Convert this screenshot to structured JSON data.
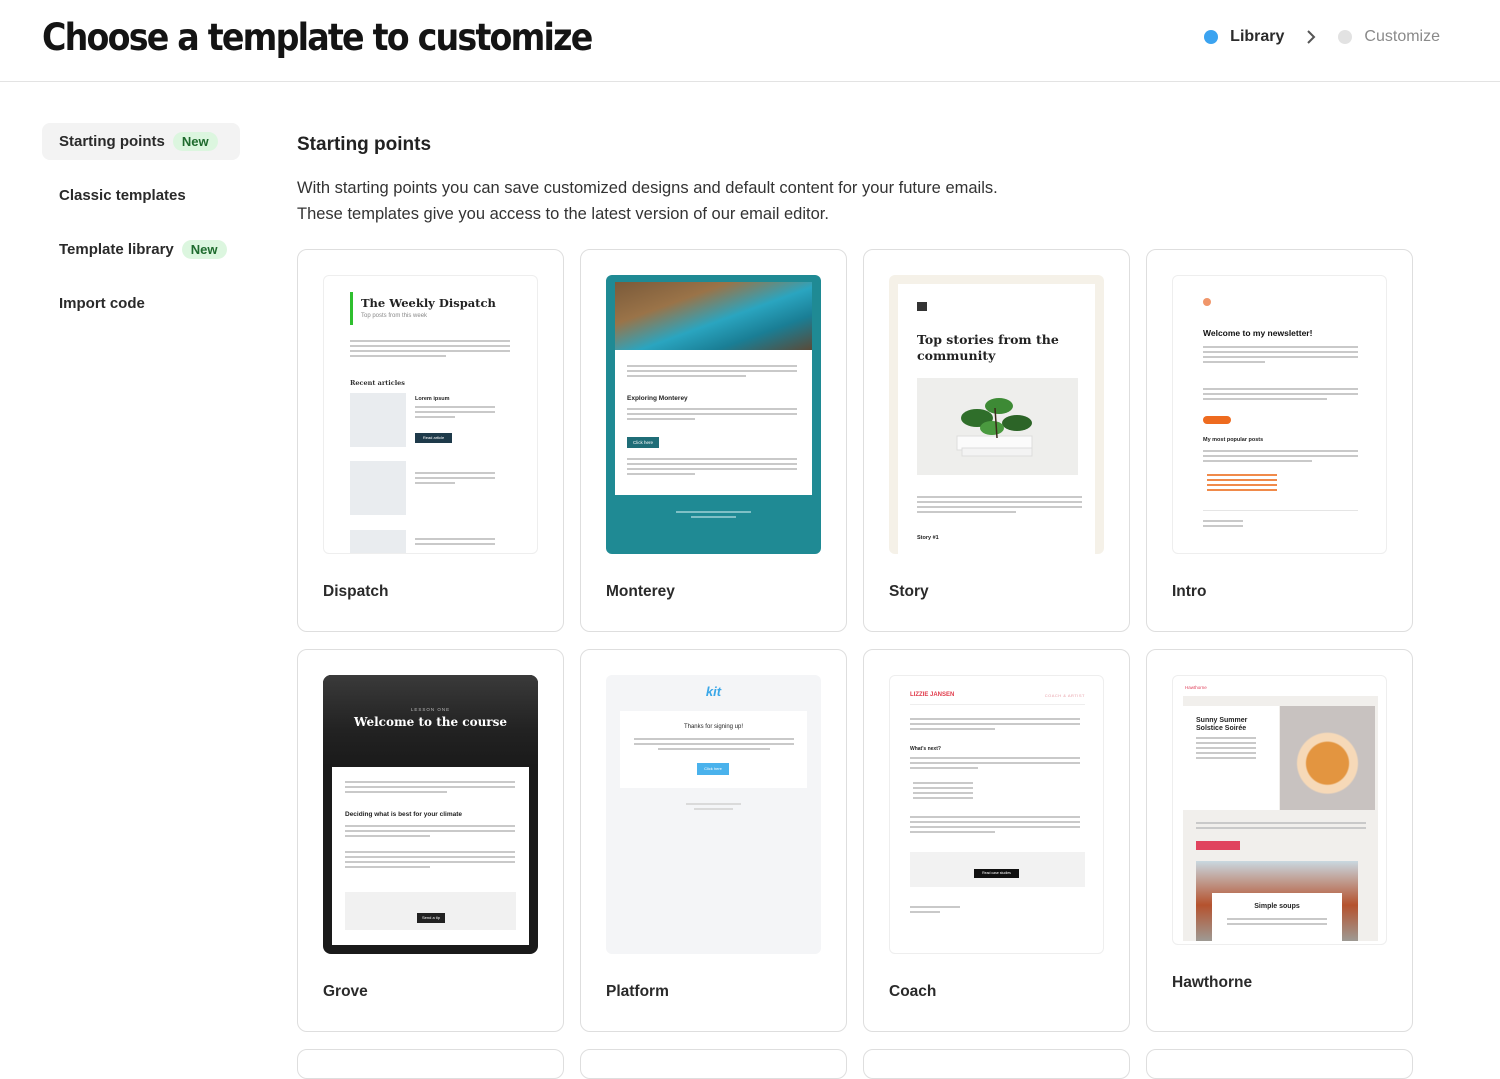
{
  "header": {
    "title": "Choose a template to customize",
    "steps": [
      {
        "label": "Library",
        "color": "#3ba3f0"
      },
      {
        "label": "Customize",
        "color": "#e2e2e2"
      }
    ]
  },
  "sidebar": {
    "items": [
      {
        "label": "Starting points",
        "badge": "New"
      },
      {
        "label": "Classic templates"
      },
      {
        "label": "Template library",
        "badge": "New"
      },
      {
        "label": "Import code"
      }
    ]
  },
  "main": {
    "title": "Starting points",
    "description_line1": "With starting points you can save customized designs and default content for your future emails.",
    "description_line2": "These templates give you access to the latest version of our email editor."
  },
  "templates": [
    {
      "name": "Dispatch",
      "preview": {
        "heading": "The Weekly Dispatch",
        "sub": "Top posts from this week",
        "section": "Recent articles",
        "item": "Lorem ipsum",
        "button": "Read article"
      }
    },
    {
      "name": "Monterey",
      "preview": {
        "heading": "Exploring Monterey",
        "button": "Click here"
      }
    },
    {
      "name": "Story",
      "preview": {
        "heading": "Top stories from the community",
        "item": "Story #1"
      }
    },
    {
      "name": "Intro",
      "preview": {
        "heading": "Welcome to my newsletter!",
        "section": "My most popular posts"
      }
    },
    {
      "name": "Grove",
      "preview": {
        "kicker": "LESSON ONE",
        "heading": "Welcome to the course",
        "section": "Deciding what is best for your climate",
        "button": "Send a tip"
      }
    },
    {
      "name": "Platform",
      "preview": {
        "logo": "kit",
        "heading": "Thanks for signing up!",
        "button": "Click here"
      }
    },
    {
      "name": "Coach",
      "preview": {
        "brand": "LIZZIE JANSEN",
        "tag": "COACH & ARTIST",
        "section": "What's next?",
        "button": "Read case studies"
      }
    },
    {
      "name": "Hawthorne",
      "preview": {
        "brand": "Hawthorne",
        "heading": "Sunny Summer Solstice Soirée",
        "section": "Simple soups"
      }
    }
  ],
  "colors": {
    "accent": "#3ba3f0",
    "badge_bg": "#dcf6df",
    "badge_fg": "#1f6b2e",
    "monterey_teal": "#1f8a94"
  }
}
